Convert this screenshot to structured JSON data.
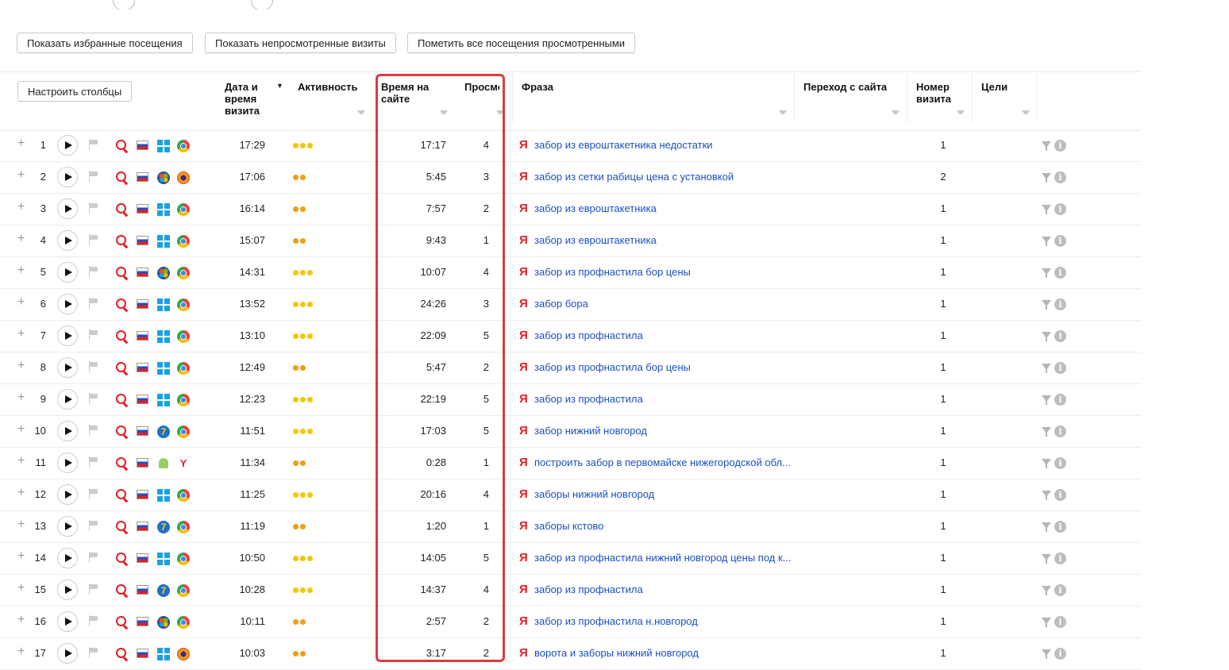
{
  "toolbar": {
    "show_favorites": "Показать избранные посещения",
    "show_unviewed": "Показать непросмотренные визиты",
    "mark_all_viewed": "Пометить все посещения просмотренными"
  },
  "table": {
    "configure_columns": "Настроить столбцы",
    "sort_indicator": "▼",
    "columns": {
      "datetime": "Дата и\nвремя\nвизита",
      "activity": "Активность",
      "duration": "Время на\nсайте",
      "views": "Просмотры",
      "phrase": "Фраза",
      "referrer": "Переход с сайта",
      "visit_number": "Номер\nвизита",
      "goals": "Цели"
    },
    "rows": [
      {
        "n": "1",
        "os": "win",
        "browser": "chrome",
        "time": "17:29",
        "activity": 3,
        "duration": "17:17",
        "views": "4",
        "phrase": "забор из евроштакетника недостатки",
        "visit": "1"
      },
      {
        "n": "2",
        "os": "xp",
        "browser": "ff",
        "time": "17:06",
        "activity": 2,
        "duration": "5:45",
        "views": "3",
        "phrase": "забор из сетки рабицы цена с установкой",
        "visit": "2"
      },
      {
        "n": "3",
        "os": "win",
        "browser": "chrome",
        "time": "16:14",
        "activity": 2,
        "duration": "7:57",
        "views": "2",
        "phrase": "забор из евроштакетника",
        "visit": "1"
      },
      {
        "n": "4",
        "os": "win",
        "browser": "chrome",
        "time": "15:07",
        "activity": 2,
        "duration": "9:43",
        "views": "1",
        "phrase": "забор из евроштакетника",
        "visit": "1"
      },
      {
        "n": "5",
        "os": "xp",
        "browser": "chrome",
        "time": "14:31",
        "activity": 3,
        "duration": "10:07",
        "views": "4",
        "phrase": "забор из профнастила бор цены",
        "visit": "1"
      },
      {
        "n": "6",
        "os": "win",
        "browser": "chrome",
        "time": "13:52",
        "activity": 3,
        "duration": "24:26",
        "views": "3",
        "phrase": "забор бора",
        "visit": "1"
      },
      {
        "n": "7",
        "os": "win",
        "browser": "chrome",
        "time": "13:10",
        "activity": 3,
        "duration": "22:09",
        "views": "5",
        "phrase": "забор из профнастила",
        "visit": "1"
      },
      {
        "n": "8",
        "os": "win",
        "browser": "chrome",
        "time": "12:49",
        "activity": 2,
        "duration": "5:47",
        "views": "2",
        "phrase": "забор из профнастила бор цены",
        "visit": "1"
      },
      {
        "n": "9",
        "os": "win",
        "browser": "chrome",
        "time": "12:23",
        "activity": 3,
        "duration": "22:19",
        "views": "5",
        "phrase": "забор из профнастила",
        "visit": "1"
      },
      {
        "n": "10",
        "os": "w7",
        "browser": "chrome",
        "time": "11:51",
        "activity": 3,
        "duration": "17:03",
        "views": "5",
        "phrase": "забор нижний новгород",
        "visit": "1"
      },
      {
        "n": "11",
        "os": "andr",
        "browser": "yb",
        "time": "11:34",
        "activity": 2,
        "duration": "0:28",
        "views": "1",
        "phrase": "построить забор в первомайске нижегородской обл...",
        "visit": "1"
      },
      {
        "n": "12",
        "os": "win",
        "browser": "chrome",
        "time": "11:25",
        "activity": 3,
        "duration": "20:16",
        "views": "4",
        "phrase": "заборы нижний новгород",
        "visit": "1"
      },
      {
        "n": "13",
        "os": "w7",
        "browser": "chrome",
        "time": "11:19",
        "activity": 2,
        "duration": "1:20",
        "views": "1",
        "phrase": "заборы кстово",
        "visit": "1"
      },
      {
        "n": "14",
        "os": "win",
        "browser": "chrome",
        "time": "10:50",
        "activity": 3,
        "duration": "14:05",
        "views": "5",
        "phrase": "забор из профнастила нижний новгород цены под к...",
        "visit": "1"
      },
      {
        "n": "15",
        "os": "w7",
        "browser": "chrome",
        "time": "10:28",
        "activity": 3,
        "duration": "14:37",
        "views": "4",
        "phrase": "забор из профнастила",
        "visit": "1"
      },
      {
        "n": "16",
        "os": "xp",
        "browser": "chrome",
        "time": "10:11",
        "activity": 2,
        "duration": "2:57",
        "views": "2",
        "phrase": "забор из профнастила н.новгород",
        "visit": "1"
      },
      {
        "n": "17",
        "os": "win",
        "browser": "ff",
        "time": "10:03",
        "activity": 2,
        "duration": "3:17",
        "views": "2",
        "phrase": "ворота и заборы нижний новгород",
        "visit": "1"
      }
    ]
  },
  "labels": {
    "search_engine_mark": "Я",
    "windows7_mark": "7",
    "yandex_browser_mark": "Y",
    "info_mark": "i",
    "plus": "+"
  },
  "colors": {
    "highlight": "#e0393e",
    "link": "#1a4fc4",
    "activity_high": "#f7c600",
    "activity_mid": "#f39c12"
  }
}
